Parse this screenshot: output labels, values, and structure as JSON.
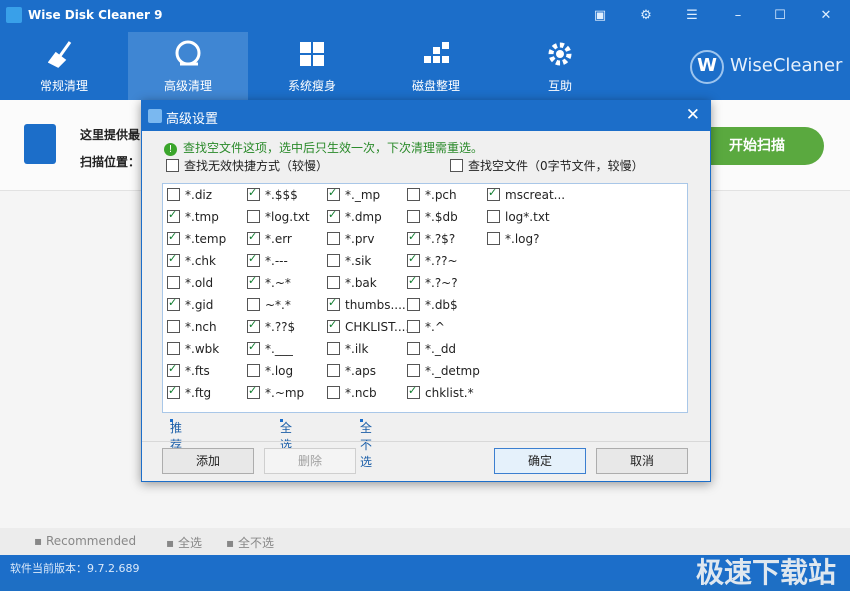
{
  "window": {
    "title": "Wise Disk Cleaner 9",
    "controls": [
      "▣",
      "⚙",
      "☰",
      "–",
      "☐",
      "✕"
    ]
  },
  "nav": {
    "items": [
      {
        "label": "常规清理",
        "icon": "broom-icon"
      },
      {
        "label": "高级清理",
        "icon": "disk-icon"
      },
      {
        "label": "系统瘦身",
        "icon": "windows-icon"
      },
      {
        "label": "磁盘整理",
        "icon": "defrag-icon"
      },
      {
        "label": "互助",
        "icon": "gear-icon"
      }
    ],
    "brand_letter": "W",
    "brand": "WiseCleaner"
  },
  "scan": {
    "line1": "这里提供最",
    "line2": "扫描位置：",
    "button": "开始扫描"
  },
  "bottom": {
    "recommended": "Recommended",
    "select_all": "全选",
    "select_none": "全不选"
  },
  "status": {
    "version": "软件当前版本：9.7.2.689",
    "watermark": "极速下载站"
  },
  "dialog": {
    "title": "高级设置",
    "note": "查找空文件这项，选中后只生效一次，下次清理需重选。",
    "opt1": "查找无效快捷方式（较慢）",
    "opt2": "查找空文件（0字节文件，较慢）",
    "links": {
      "recommend": "推荐",
      "all": "全选",
      "none": "全不选"
    },
    "buttons": {
      "add": "添加",
      "delete": "删除",
      "ok": "确定",
      "cancel": "取消"
    },
    "items": [
      [
        {
          "t": "*.diz",
          "c": false
        },
        {
          "t": "*.tmp",
          "c": true
        },
        {
          "t": "*.temp",
          "c": true
        },
        {
          "t": "*.chk",
          "c": true
        },
        {
          "t": "*.old",
          "c": false
        },
        {
          "t": "*.gid",
          "c": true
        },
        {
          "t": "*.nch",
          "c": false
        },
        {
          "t": "*.wbk",
          "c": false
        },
        {
          "t": "*.fts",
          "c": true
        },
        {
          "t": "*.ftg",
          "c": true
        }
      ],
      [
        {
          "t": "*.$$$",
          "c": true
        },
        {
          "t": "*log.txt",
          "c": false
        },
        {
          "t": "*.err",
          "c": true
        },
        {
          "t": "*.---",
          "c": true
        },
        {
          "t": "*.~*",
          "c": true
        },
        {
          "t": "~*.*",
          "c": false
        },
        {
          "t": "*.??$",
          "c": true
        },
        {
          "t": "*.___",
          "c": true
        },
        {
          "t": "*.log",
          "c": false
        },
        {
          "t": "*.~mp",
          "c": true
        }
      ],
      [
        {
          "t": "*._mp",
          "c": true
        },
        {
          "t": "*.dmp",
          "c": true
        },
        {
          "t": "*.prv",
          "c": false
        },
        {
          "t": "*.sik",
          "c": false
        },
        {
          "t": "*.bak",
          "c": false
        },
        {
          "t": "thumbs....",
          "c": true
        },
        {
          "t": "CHKLIST....",
          "c": true
        },
        {
          "t": "*.ilk",
          "c": false
        },
        {
          "t": "*.aps",
          "c": false
        },
        {
          "t": "*.ncb",
          "c": false
        }
      ],
      [
        {
          "t": "*.pch",
          "c": false
        },
        {
          "t": "*.$db",
          "c": false
        },
        {
          "t": "*.?$?",
          "c": true
        },
        {
          "t": "*.??~",
          "c": true
        },
        {
          "t": "*.?~?",
          "c": true
        },
        {
          "t": "*.db$",
          "c": false
        },
        {
          "t": "*.^",
          "c": false
        },
        {
          "t": "*._dd",
          "c": false
        },
        {
          "t": "*._detmp",
          "c": false
        },
        {
          "t": "chklist.*",
          "c": true
        }
      ],
      [
        {
          "t": "mscreat...",
          "c": true
        },
        {
          "t": "log*.txt",
          "c": false
        },
        {
          "t": "*.log?",
          "c": false
        }
      ]
    ]
  }
}
